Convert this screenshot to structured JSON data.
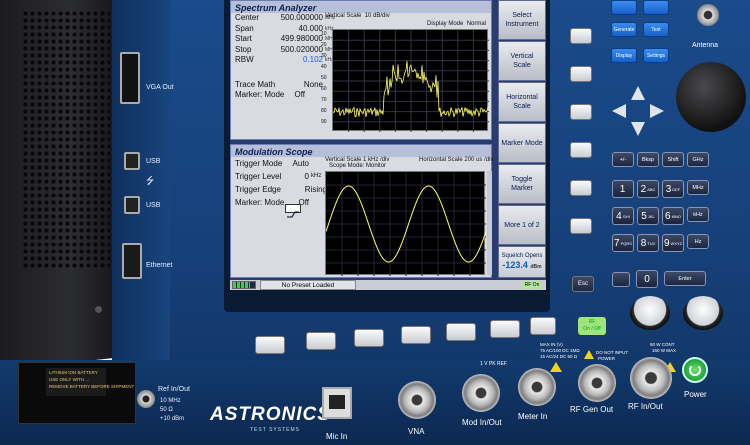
{
  "brand": {
    "name": "ASTRONICS",
    "sub": "TEST SYSTEMS"
  },
  "spectrum": {
    "title": "Spectrum Analyzer",
    "rows": [
      {
        "k": "Center",
        "v": "500.000000",
        "u": "MHz"
      },
      {
        "k": "Span",
        "v": "40.000",
        "u": "kHz"
      },
      {
        "k": "Start",
        "v": "499.980000",
        "u": "MHz"
      },
      {
        "k": "Stop",
        "v": "500.020000",
        "u": "MHz"
      },
      {
        "k": "RBW",
        "v": "0.102",
        "u": "kHz"
      }
    ],
    "trace_math": {
      "k": "Trace Math",
      "v": "None"
    },
    "marker_mode": {
      "k": "Marker: Mode",
      "v": "Off"
    },
    "plot_head": {
      "scale": "Vertical Scale",
      "scale_val": "10 dB/div",
      "mode": "Display Mode",
      "mode_val": "Normal"
    },
    "y_ticks": [
      "10",
      "20",
      "30",
      "40",
      "50",
      "60",
      "70",
      "80",
      "90"
    ]
  },
  "modulation": {
    "title": "Modulation Scope",
    "rows": [
      {
        "k": "Trigger Mode",
        "v": "Auto",
        "u": ""
      },
      {
        "k": "Trigger Level",
        "v": "0",
        "u": "kHz"
      },
      {
        "k": "Trigger Edge",
        "v": "Rising",
        "u": ""
      },
      {
        "k": "Marker: Mode",
        "v": "Off",
        "u": ""
      }
    ],
    "plot_head": {
      "vscale": "Vertical Scale",
      "vscale_val": "1 kHz /div",
      "hscale": "Horizontal Scale",
      "hscale_val": "200 us /div",
      "mode": "Scope Mode: Monitor"
    }
  },
  "softkeys": [
    "Select Instrument",
    "Vertical Scale",
    "Horizontal Scale",
    "Marker Mode",
    "Toggle Marker",
    "More 1 of 2"
  ],
  "squelch": {
    "label": "Squelch Opens",
    "value": "-123.4",
    "unit": "dBm"
  },
  "status": {
    "preset": "No Preset Loaded",
    "rf": "RF On"
  },
  "blue_keys": [
    "Generate",
    "Test",
    "Display",
    "Settings"
  ],
  "func_keys": [
    "+/-",
    "Bksp",
    "Shift",
    "GHz"
  ],
  "num_keys": [
    {
      "d": "1",
      "s": ""
    },
    {
      "d": "2",
      "s": "ABC"
    },
    {
      "d": "3",
      "s": "DEF"
    },
    {
      "u": "MHz"
    },
    {
      "d": "4",
      "s": "GHI"
    },
    {
      "d": "5",
      "s": "JKL"
    },
    {
      "d": "6",
      "s": "MNO"
    },
    {
      "u": "kHz"
    },
    {
      "d": "7",
      "s": "PQRS"
    },
    {
      "d": "8",
      "s": "TUV"
    },
    {
      "d": "9",
      "s": "WXYZ"
    },
    {
      "u": "Hz"
    }
  ],
  "bottom_keys": {
    "esc": "Esc",
    "zero": "0",
    "enter": "Enter"
  },
  "rf_button": {
    "line1": "RF",
    "line2": "On / Off"
  },
  "side_ports": {
    "vga": "VGA Out",
    "usb1": "USB",
    "usb2": "USB",
    "ethernet": "Ethernet"
  },
  "ref_io": {
    "label": "Ref In/Out",
    "lines": [
      "10 MHz",
      "50 Ω",
      "+10 dBm"
    ]
  },
  "battery": {
    "lines": [
      "LITHIUM ION BATTERY",
      "USE ONLY WITH ...",
      "REMOVE BATTERY BEFORE SHIPMENT"
    ]
  },
  "front_ports": {
    "mic": "Mic In",
    "vna": "VNA",
    "mod": "Mod In/Out",
    "meter": "Meter In",
    "rfgen": "RF Gen Out",
    "rfio": "RF In/Out",
    "power": "Power",
    "antenna": "Antenna"
  },
  "port_notes": {
    "mod_ref": "1 V PK REF",
    "meter": [
      "MAX IN (V)",
      "75 AC/100 DC 1MΩ",
      "15 AC/24 DC 50 Ω"
    ],
    "rfgen": [
      "DO NOT INPUT",
      "POWER"
    ],
    "rfio": [
      "50 W CONT",
      "150 W MAX"
    ]
  },
  "colors": {
    "body": "#163f78",
    "trace": "#ffff66",
    "plot_bg": "#000000"
  }
}
